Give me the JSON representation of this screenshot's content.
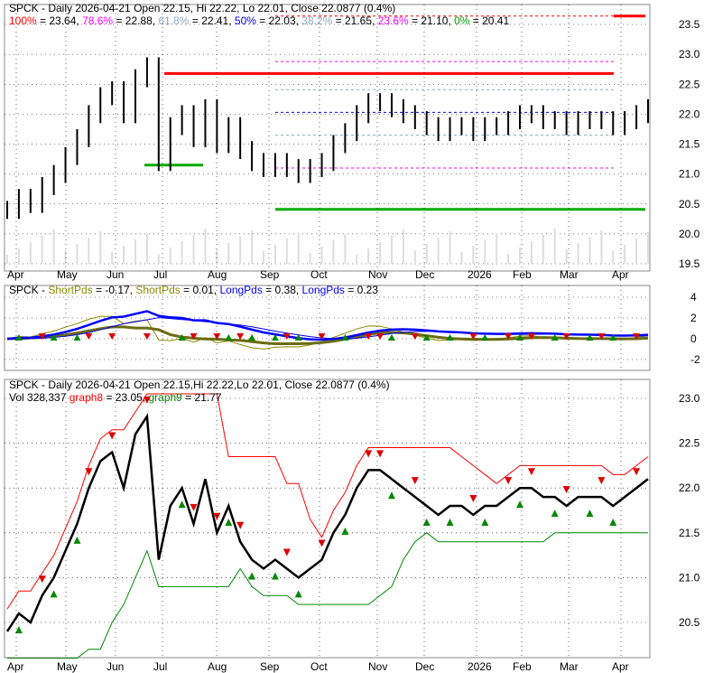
{
  "panel1": {
    "title": "SPCK - Daily 2026-04-21 Open 22.15, Hi 22.22, Lo 22.01, Close 22.0877 (0.4%)",
    "fib": [
      {
        "label": "100%",
        "value": "23.64",
        "color": "#ff0000",
        "level": 23.64
      },
      {
        "label": "78.6%",
        "value": "22.88",
        "color": "#ff00ff",
        "level": 22.88
      },
      {
        "label": "61.8%",
        "value": "22.41",
        "color": "#8fa8c8",
        "level": 22.41
      },
      {
        "label": "50%",
        "value": "22.03",
        "color": "#0000ff",
        "level": 22.03
      },
      {
        "label": "38.2%",
        "value": "21.65",
        "color": "#8fa8c8",
        "level": 21.65
      },
      {
        "label": "23.6%",
        "value": "21.10",
        "color": "#ff00ff",
        "level": 21.1
      },
      {
        "label": "0%",
        "value": "20.41",
        "color": "#00a000",
        "level": 20.41
      }
    ],
    "yticks": [
      "23.5",
      "23.0",
      "22.5",
      "22.0",
      "21.5",
      "21.0",
      "20.5",
      "20.0",
      "19.5"
    ]
  },
  "panel2": {
    "prefix": "SPCK - ",
    "legend": [
      {
        "label": "ShortPds",
        "value": " = -0.17, ",
        "color": "#8b8b00"
      },
      {
        "label": "ShortPds",
        "value": " = 0.01, ",
        "color": "#8b8b00"
      },
      {
        "label": "LongPds",
        "value": " = 0.38, ",
        "color": "#0000ff"
      },
      {
        "label": "LongPds",
        "value": " = 0.23",
        "color": "#0000ff"
      }
    ],
    "yticks": [
      "4",
      "2",
      "0",
      "-2"
    ]
  },
  "panel3": {
    "title": "SPCK - Daily 2026-04-21 Open 22.15,Hi 22.22,Lo 22.01, Close 22.0877 (0.4%)",
    "vol": "Vol 328,337 ",
    "g8_label": "graph8",
    "g8_value": " = 23.05, ",
    "g9_label": "graph9",
    "g9_value": " = 21.77",
    "yticks": [
      "23.0",
      "22.5",
      "22.0",
      "21.5",
      "21.0",
      "20.5"
    ]
  },
  "xlabels": [
    "Apr",
    "May",
    "Jun",
    "Jul",
    "Aug",
    "Sep",
    "Oct",
    "Nov",
    "Dec",
    "2026",
    "Feb",
    "Mar",
    "Apr"
  ],
  "chart_data": {
    "type": "line",
    "ticker": "SPCK",
    "closes": [
      20.4,
      20.6,
      20.5,
      20.8,
      21.0,
      21.3,
      21.6,
      22.0,
      22.3,
      22.4,
      22.0,
      22.6,
      22.8,
      21.2,
      21.8,
      22.0,
      21.6,
      22.1,
      21.5,
      21.8,
      21.4,
      21.2,
      21.1,
      21.2,
      21.1,
      21.0,
      21.1,
      21.2,
      21.5,
      21.7,
      22.0,
      22.2,
      22.2,
      22.1,
      22.0,
      21.9,
      21.8,
      21.7,
      21.8,
      21.8,
      21.7,
      21.8,
      21.8,
      21.9,
      22.0,
      22.0,
      21.9,
      21.9,
      21.8,
      21.9,
      21.9,
      21.9,
      21.8,
      21.9,
      22.0,
      22.1
    ],
    "buy_arrows": [
      1,
      4,
      6,
      15,
      19,
      21,
      23,
      25,
      29,
      33,
      36,
      38,
      41,
      44,
      47,
      50,
      52
    ],
    "sell_arrows": [
      3,
      7,
      9,
      12,
      16,
      18,
      20,
      24,
      27,
      31,
      32,
      35,
      40,
      43,
      45,
      48,
      51,
      54
    ]
  }
}
